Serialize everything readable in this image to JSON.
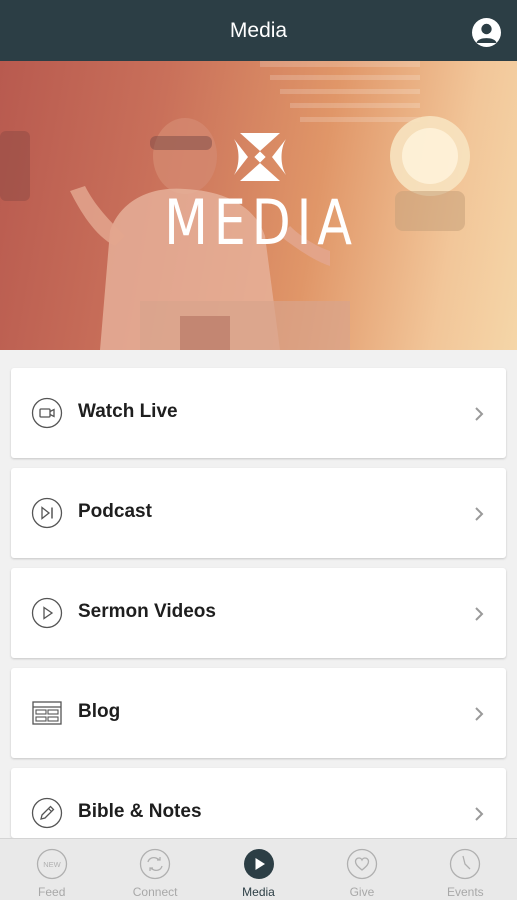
{
  "header": {
    "title": "Media",
    "profile_icon": "user-icon"
  },
  "hero": {
    "title": "MEDIA",
    "logo_icon": "church-logo-icon"
  },
  "menu": {
    "items": [
      {
        "label": "Watch Live",
        "icon": "video-camera-icon"
      },
      {
        "label": "Podcast",
        "icon": "play-pause-icon"
      },
      {
        "label": "Sermon Videos",
        "icon": "play-icon"
      },
      {
        "label": "Blog",
        "icon": "newspaper-icon"
      },
      {
        "label": "Bible & Notes",
        "icon": "pencil-icon"
      }
    ]
  },
  "tabbar": {
    "active": "Media",
    "tabs": [
      {
        "label": "Feed",
        "icon": "new-badge-icon",
        "badge": "NEW"
      },
      {
        "label": "Connect",
        "icon": "sync-arrows-icon"
      },
      {
        "label": "Media",
        "icon": "play-circle-icon"
      },
      {
        "label": "Give",
        "icon": "heart-icon"
      },
      {
        "label": "Events",
        "icon": "clock-icon"
      }
    ]
  },
  "colors": {
    "header_bg": "#2c3e45",
    "active_tab": "#2c3e45",
    "inactive_tab": "#a8a8a8"
  }
}
